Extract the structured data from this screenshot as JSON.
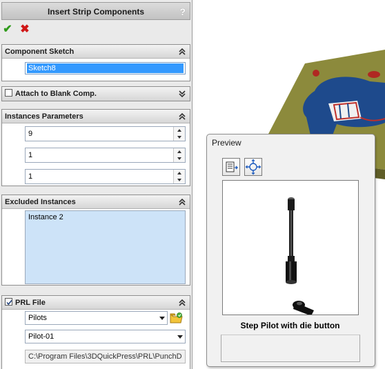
{
  "panel": {
    "title": "Insert Strip Components",
    "help": "?"
  },
  "actions": {
    "ok": "✔",
    "cancel": "✖"
  },
  "component_sketch": {
    "header": "Component Sketch",
    "value": "Sketch8"
  },
  "attach_blank": {
    "label": "Attach to Blank Comp.",
    "checked": false
  },
  "instances": {
    "header": "Instances Parameters",
    "values": [
      "9",
      "1",
      "1"
    ]
  },
  "excluded": {
    "header": "Excluded Instances",
    "items": [
      "Instance 2"
    ]
  },
  "prl_file": {
    "label": "PRL File",
    "checked": true,
    "category": "Pilots",
    "item": "Pilot-01",
    "path": "C:\\Program Files\\3DQuickPress\\PRL\\PunchD"
  },
  "preview": {
    "title": "Preview",
    "caption": "Step Pilot with die button"
  },
  "colors": {
    "accent_selection": "#3399ff",
    "ok_green": "#2f9a1a",
    "cancel_red": "#d01818",
    "model_olive": "#8c8a3c",
    "model_blue": "#1e4a8c"
  }
}
